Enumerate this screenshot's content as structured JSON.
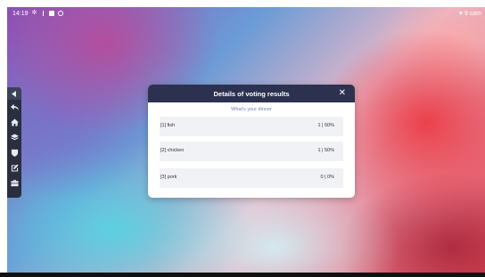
{
  "status_bar": {
    "time": "14:19",
    "icons": [
      "gear-icon",
      "download-icon",
      "square-icon",
      "circle-icon"
    ],
    "right_text": "9 cam"
  },
  "side_toolbar": {
    "items": [
      {
        "icon": "chevron-left-icon"
      },
      {
        "icon": "back-icon"
      },
      {
        "icon": "home-icon"
      },
      {
        "icon": "layers-icon"
      },
      {
        "icon": "shield-icon"
      },
      {
        "icon": "edit-icon"
      },
      {
        "icon": "toolbox-icon"
      }
    ]
  },
  "dialog": {
    "title": "Details of voting results",
    "close_label": "✕",
    "question": "What's your dinner",
    "options": [
      {
        "label": "[1] fish",
        "result": "1 | 50%"
      },
      {
        "label": "[2] chicken",
        "result": "1 | 50%"
      },
      {
        "label": "[3] pork",
        "result": "0 | 0%"
      }
    ]
  },
  "colors": {
    "dialog_header": "#2d3150",
    "option_bg": "#f1f2f5",
    "question_text": "#6e7fb0",
    "toolbar_bg": "#2a2f3f"
  }
}
